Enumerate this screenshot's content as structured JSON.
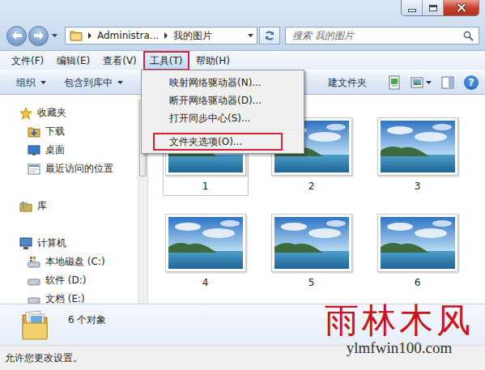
{
  "address": {
    "crumbs": [
      "Administra...",
      "我的图片"
    ]
  },
  "search": {
    "placeholder": "搜索 我的图片"
  },
  "menu_bar": [
    {
      "label": "文件(F)",
      "selected": false
    },
    {
      "label": "编辑(E)",
      "selected": false
    },
    {
      "label": "查看(V)",
      "selected": false
    },
    {
      "label": "工具(T)",
      "selected": true
    },
    {
      "label": "帮助(H)",
      "selected": false
    }
  ],
  "toolbar": {
    "buttons": [
      "组织",
      "包含到库中"
    ],
    "partial_button": "建文件夹",
    "help": "?"
  },
  "tools_menu": [
    {
      "kind": "item",
      "label": "映射网络驱动器(N)...",
      "selected": false
    },
    {
      "kind": "item",
      "label": "断开网络驱动器(D)...",
      "selected": false
    },
    {
      "kind": "item",
      "label": "打开同步中心(S)...",
      "selected": false
    },
    {
      "kind": "separator",
      "selected": false
    },
    {
      "kind": "item",
      "label": "文件夹选项(O)...",
      "selected": true
    }
  ],
  "navigation": [
    {
      "label": "收藏夹",
      "kind": "group"
    },
    {
      "label": "下载",
      "kind": "item"
    },
    {
      "label": "桌面",
      "kind": "item"
    },
    {
      "label": "最近访问的位置",
      "kind": "item"
    },
    {
      "label": "库",
      "kind": "group"
    },
    {
      "label": "计算机",
      "kind": "group"
    },
    {
      "label": "本地磁盘 (C:)",
      "kind": "item"
    },
    {
      "label": "软件 (D:)",
      "kind": "item"
    },
    {
      "label": "文档 (E:)",
      "kind": "item"
    }
  ],
  "items": [
    {
      "label": "1",
      "focused": true
    },
    {
      "label": "2",
      "focused": false
    },
    {
      "label": "3",
      "focused": false
    },
    {
      "label": "4",
      "focused": false
    },
    {
      "label": "5",
      "focused": false
    },
    {
      "label": "6",
      "focused": false
    }
  ],
  "details": {
    "count": "6 个对象"
  },
  "status_bar": "允许您更改设置。",
  "watermark": {
    "title": "雨林木风",
    "url": "ylmfwin100.com"
  }
}
